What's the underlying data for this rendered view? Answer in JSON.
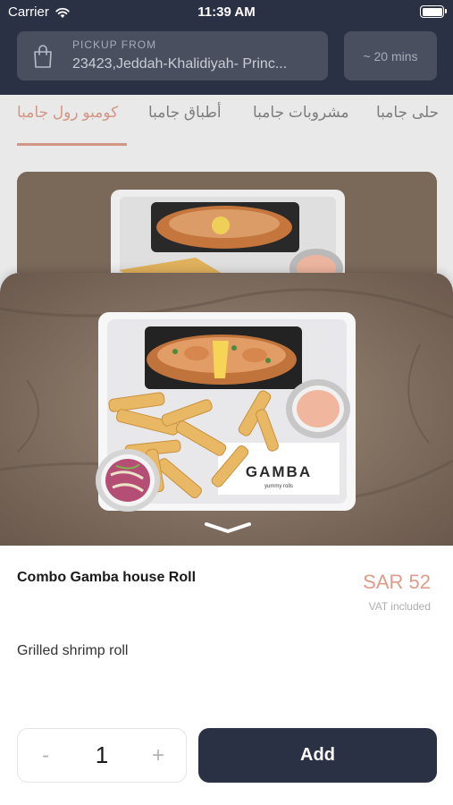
{
  "status_bar": {
    "carrier": "Carrier",
    "time": "11:39 AM"
  },
  "header": {
    "pickup_label": "PICKUP FROM",
    "pickup_address": "23423,Jeddah-Khalidiyah- Princ...",
    "eta": "~ 20 mins"
  },
  "tabs": [
    {
      "label": "كومبو رول جامبا",
      "active": true
    },
    {
      "label": "أطباق جامبا",
      "active": false
    },
    {
      "label": "مشروبات جامبا",
      "active": false
    },
    {
      "label": "حلى جامبا",
      "active": false
    }
  ],
  "product": {
    "name": "Combo Gamba house Roll",
    "price": "SAR 52",
    "vat_note": "VAT included",
    "description": "Grilled shrimp roll",
    "image_logo": "GAMBA",
    "image_logo_sub": "yummy rolls"
  },
  "order": {
    "minus": "-",
    "quantity": "1",
    "plus": "+",
    "add_label": "Add"
  },
  "colors": {
    "header_bg": "#2b3144",
    "accent": "#df9c8a",
    "add_button": "#2b3144"
  },
  "icons": {
    "wifi": "wifi-icon",
    "battery": "battery-icon",
    "bag": "shopping-bag-icon",
    "handle": "chevron-down-icon"
  }
}
